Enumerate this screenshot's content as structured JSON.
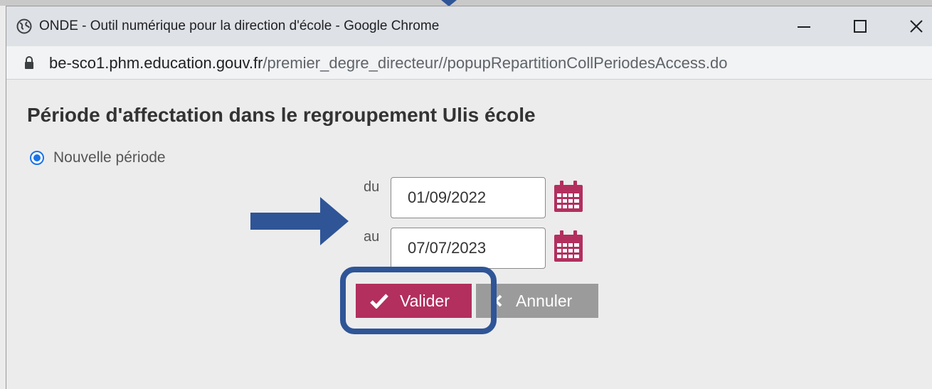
{
  "window": {
    "title": "ONDE - Outil numérique pour la direction d'école - Google Chrome",
    "app_icon": "chrome-globe-icon",
    "controls": [
      "minimize-icon",
      "maximize-icon",
      "close-icon"
    ]
  },
  "address_bar": {
    "domain": "be-sco1.phm.education.gouv.fr",
    "path": "/premier_degre_directeur//popupRepartitionCollPeriodesAccess.do",
    "icon": "lock-icon"
  },
  "page": {
    "title": "Période d'affectation dans le regroupement Ulis école",
    "radio_label": "Nouvelle période",
    "radio_selected": true,
    "from_label": "du",
    "from_value": "01/09/2022",
    "to_label": "au",
    "to_value": "07/07/2023",
    "validate_label": "Valider",
    "cancel_label": "Annuler"
  },
  "colors": {
    "validate_button": "#b22f5e",
    "cancel_button": "#9b9b9b",
    "calendar_icon": "#b22f5e",
    "annotation": "#2f5597",
    "radio": "#1a73e8"
  },
  "annotations": [
    "arrow-right-annotation",
    "highlight-box-annotation",
    "top-pointer-annotation"
  ]
}
